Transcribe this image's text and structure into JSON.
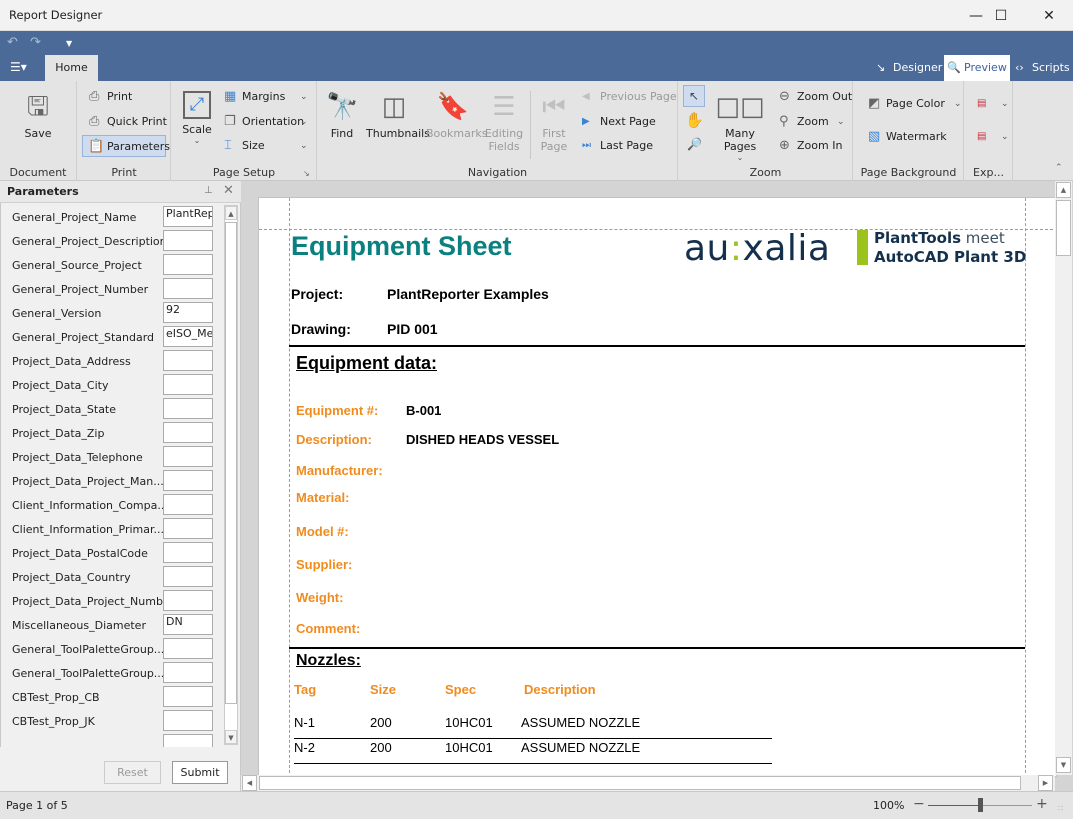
{
  "window": {
    "title": "Report Designer",
    "minimize_icon": "minimize-icon",
    "maximize_icon": "maximize-icon",
    "close_icon": "close-icon"
  },
  "qat": {
    "undo_icon": "undo-icon",
    "redo_icon": "redo-icon",
    "customize_icon": "dropdown-icon"
  },
  "tabs": {
    "file_icon": "file-menu-icon",
    "home": "Home"
  },
  "view_tabs": [
    {
      "label": "Designer",
      "icon": "designer-icon",
      "active": false
    },
    {
      "label": "Preview",
      "icon": "preview-icon",
      "active": true
    },
    {
      "label": "Scripts",
      "icon": "scripts-icon",
      "active": false
    }
  ],
  "ribbon": {
    "document": {
      "label": "Document",
      "save": "Save"
    },
    "print": {
      "label": "Print",
      "print": "Print",
      "quick_print": "Quick Print",
      "parameters": "Parameters"
    },
    "page_setup": {
      "label": "Page Setup",
      "scale": "Scale",
      "margins": "Margins",
      "orientation": "Orientation",
      "size": "Size"
    },
    "navigation": {
      "label": "Navigation",
      "find": "Find",
      "thumbnails": "Thumbnails",
      "bookmarks": "Bookmarks",
      "editing_fields_1": "Editing",
      "editing_fields_2": "Fields",
      "first_page_1": "First",
      "first_page_2": "Page",
      "previous_page": "Previous Page",
      "next_page": "Next  Page",
      "last_page": "Last  Page"
    },
    "zoom": {
      "label": "Zoom",
      "many_pages": "Many Pages",
      "zoom_out": "Zoom Out",
      "zoom": "Zoom",
      "zoom_in": "Zoom In"
    },
    "page_background": {
      "label": "Page Background",
      "page_color": "Page Color",
      "watermark": "Watermark"
    },
    "export": {
      "label": "Exp..."
    }
  },
  "parameters_panel": {
    "title": "Parameters",
    "items": [
      {
        "label": "General_Project_Name",
        "value": "PlantRep"
      },
      {
        "label": "General_Project_Description",
        "value": ""
      },
      {
        "label": "General_Source_Project",
        "value": ""
      },
      {
        "label": "General_Project_Number",
        "value": ""
      },
      {
        "label": "General_Version",
        "value": "92"
      },
      {
        "label": "General_Project_Standard",
        "value": "eISO_Me"
      },
      {
        "label": "Project_Data_Address",
        "value": ""
      },
      {
        "label": "Project_Data_City",
        "value": ""
      },
      {
        "label": "Project_Data_State",
        "value": ""
      },
      {
        "label": "Project_Data_Zip",
        "value": ""
      },
      {
        "label": "Project_Data_Telephone",
        "value": ""
      },
      {
        "label": "Project_Data_Project_Man...",
        "value": ""
      },
      {
        "label": "Client_Information_Compa...",
        "value": ""
      },
      {
        "label": "Client_Information_Primar...",
        "value": ""
      },
      {
        "label": "Project_Data_PostalCode",
        "value": ""
      },
      {
        "label": "Project_Data_Country",
        "value": ""
      },
      {
        "label": "Project_Data_Project_Number",
        "value": ""
      },
      {
        "label": "Miscellaneous_Diameter",
        "value": "DN"
      },
      {
        "label": "General_ToolPaletteGroup...",
        "value": ""
      },
      {
        "label": "General_ToolPaletteGroup...",
        "value": ""
      },
      {
        "label": "CBTest_Prop_CB",
        "value": ""
      },
      {
        "label": "CBTest_Prop_JK",
        "value": ""
      },
      {
        "label": "",
        "value": ""
      }
    ],
    "reset": "Reset",
    "submit": "Submit"
  },
  "document": {
    "title": "Equipment Sheet",
    "logo": {
      "brand_a": "au",
      "brand_dot": ":",
      "brand_b": "xalia",
      "line1_bold": "PlantTools",
      "line1_thin": " meet",
      "line2": "AutoCAD Plant 3D"
    },
    "project_label": "Project:",
    "project_value": "PlantReporter Examples",
    "drawing_label": "Drawing:",
    "drawing_value": "PID 001",
    "equipment_section": "Equipment data:",
    "fields": [
      {
        "label": "Equipment #:",
        "value": "B-001"
      },
      {
        "label": "Description:",
        "value": "DISHED HEADS VESSEL"
      },
      {
        "label": "Manufacturer:",
        "value": ""
      },
      {
        "label": "Material:",
        "value": ""
      },
      {
        "label": "Model #:",
        "value": ""
      },
      {
        "label": "Supplier:",
        "value": ""
      },
      {
        "label": "Weight:",
        "value": ""
      },
      {
        "label": "Comment:",
        "value": ""
      }
    ],
    "nozzles_section": "Nozzles:",
    "nozzle_columns": [
      "Tag",
      "Size",
      "Spec",
      "Description"
    ],
    "nozzles": [
      [
        "N-1",
        "200",
        "10HC01",
        "ASSUMED NOZZLE"
      ],
      [
        "N-2",
        "200",
        "10HC01",
        "ASSUMED NOZZLE"
      ]
    ],
    "colors": {
      "title": "#0b8080",
      "label": "#f08c1e",
      "logo_green": "#9bc31c",
      "logo_navy": "#14304c"
    }
  },
  "statusbar": {
    "page_info": "Page 1 of 5",
    "zoom_label": "100%",
    "zoom_slider_fraction": 0.5
  }
}
